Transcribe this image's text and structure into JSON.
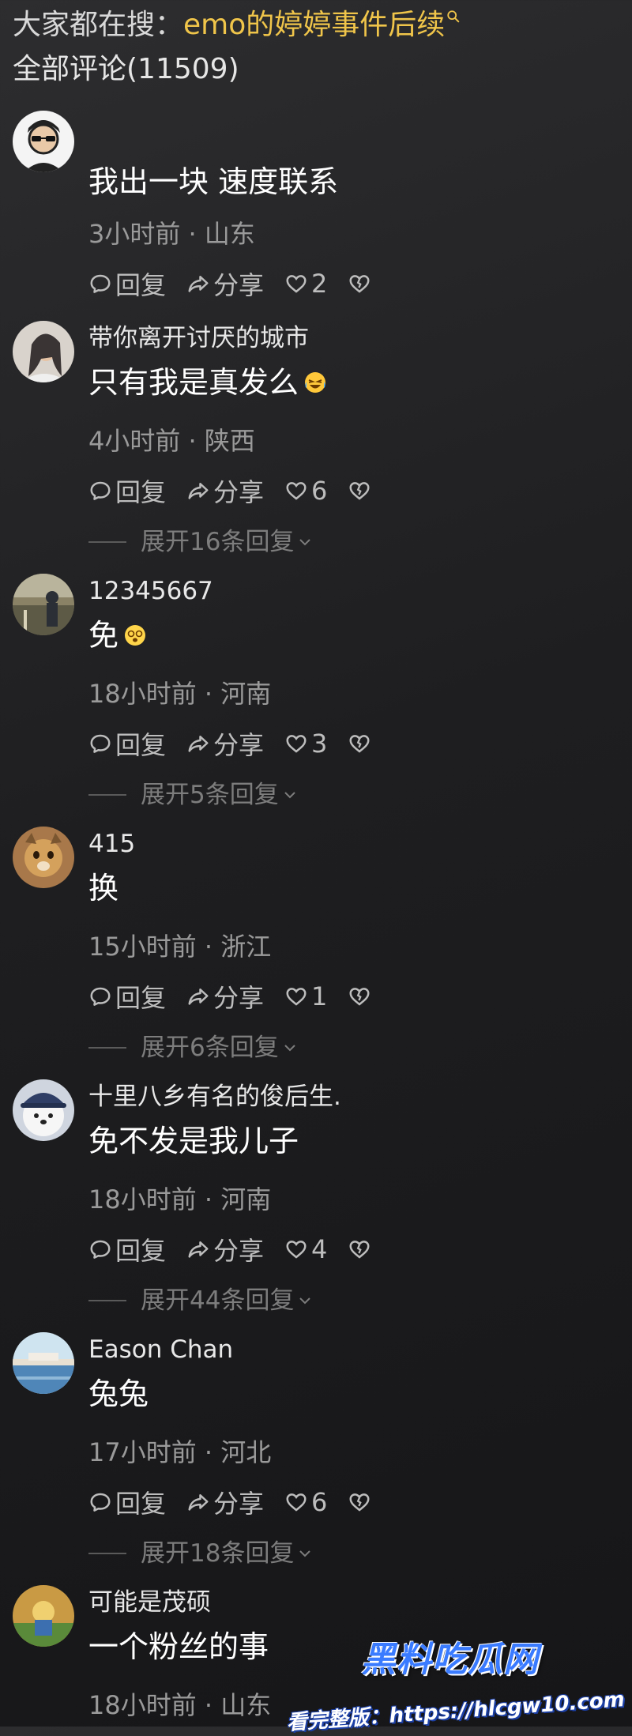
{
  "header": {
    "search_prefix": "大家都在搜：",
    "search_term": "emo的婷婷事件后续",
    "comments_count_label": "全部评论(11509)"
  },
  "actions": {
    "reply": "回复",
    "share": "分享"
  },
  "comments": [
    {
      "author": "",
      "content": "我出一块 速度联系",
      "meta": "3小时前 · 山东",
      "likes": "2",
      "expand": "",
      "avatar_colors": [
        "#f4f4f4",
        "#222222"
      ]
    },
    {
      "author": "带你离开讨厌的城市",
      "content": "只有我是真发么",
      "emoji": "laughing-crying-emoji",
      "meta": "4小时前 · 陕西",
      "likes": "6",
      "expand": "展开16条回复",
      "avatar_colors": [
        "#d9d3cc",
        "#3a3434"
      ]
    },
    {
      "author": "12345667",
      "content": "免",
      "emoji": "dizzy-face-emoji",
      "meta": "18小时前 · 河南",
      "likes": "3",
      "expand": "展开5条回复",
      "avatar_colors": [
        "#8a8266",
        "#2b2f36"
      ]
    },
    {
      "author": "415",
      "content": "换",
      "meta": "15小时前 · 浙江",
      "likes": "1",
      "expand": "展开6条回复",
      "avatar_colors": [
        "#d4a15c",
        "#7a5630"
      ]
    },
    {
      "author": "十里八乡有名的俊后生.",
      "content": "免不发是我儿子",
      "meta": "18小时前 · 河南",
      "likes": "4",
      "expand": "展开44条回复",
      "avatar_colors": [
        "#f4f4f4",
        "#2f3e66"
      ]
    },
    {
      "author": "Eason Chan",
      "content": "兔兔",
      "meta": "17小时前 · 河北",
      "likes": "6",
      "expand": "展开18条回复",
      "avatar_colors": [
        "#cfe4f0",
        "#4f86b8"
      ]
    },
    {
      "author": "可能是茂硕",
      "content": "一个粉丝的事",
      "meta": "18小时前 · 山东",
      "likes": "",
      "expand": "",
      "avatar_colors": [
        "#c99a44",
        "#5a8a3a"
      ]
    }
  ],
  "watermark": {
    "brand": "黑料吃瓜网",
    "url_text": "看完整版：https://hlcgw10.com"
  },
  "colors": {
    "search_highlight": "#f0c54a",
    "meta_gray": "#9a9a9a"
  }
}
